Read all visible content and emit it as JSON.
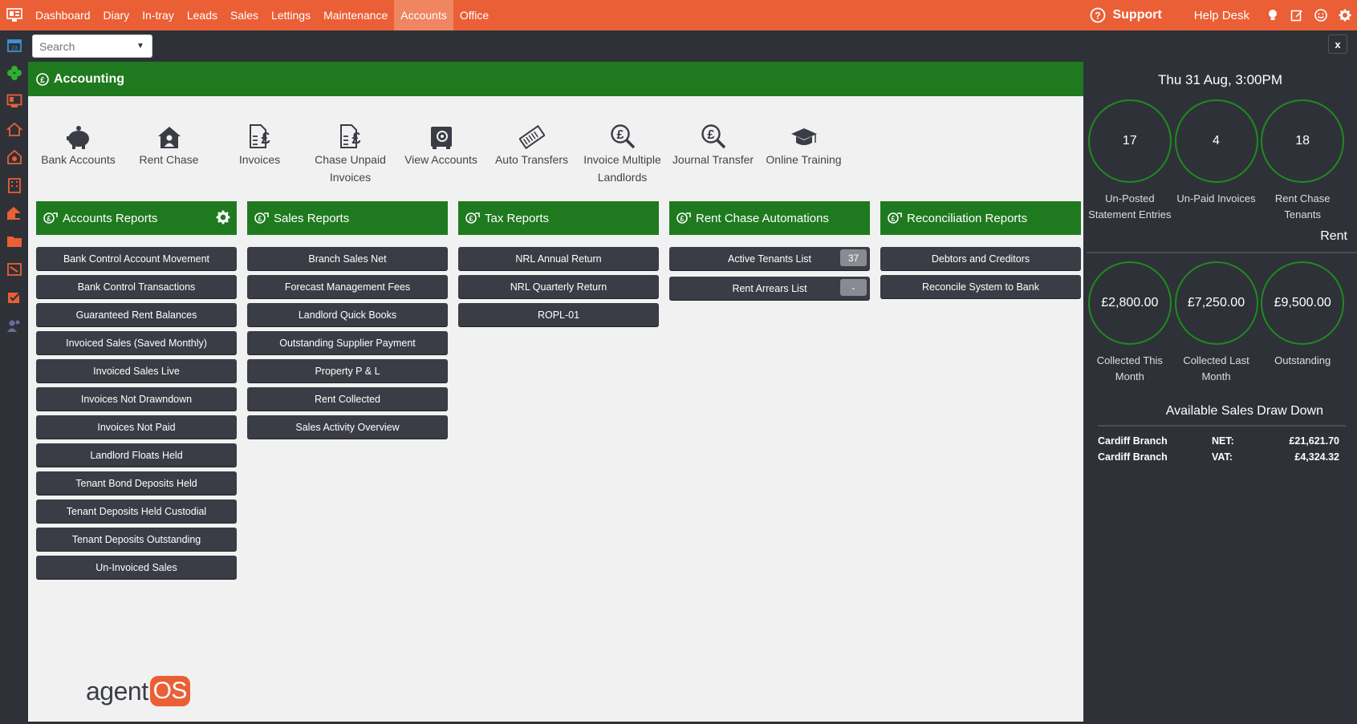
{
  "nav": {
    "items": [
      "Dashboard",
      "Diary",
      "In-tray",
      "Leads",
      "Sales",
      "Lettings",
      "Maintenance",
      "Accounts",
      "Office"
    ],
    "active": "Accounts",
    "support": "Support",
    "help_desk": "Help Desk"
  },
  "search": {
    "placeholder": "Search"
  },
  "close_label": "x",
  "page": {
    "title": "Accounting"
  },
  "tools": [
    {
      "label": "Bank Accounts",
      "icon": "piggy-bank-icon"
    },
    {
      "label": "Rent Chase",
      "icon": "house-user-icon"
    },
    {
      "label": "Invoices",
      "icon": "invoice-pound-icon"
    },
    {
      "label": "Chase Unpaid Invoices",
      "icon": "invoice-pound-icon"
    },
    {
      "label": "View Accounts",
      "icon": "safe-icon"
    },
    {
      "label": "Auto Transfers",
      "icon": "money-transfer-icon"
    },
    {
      "label": "Invoice Multiple Landlords",
      "icon": "search-pound-icon"
    },
    {
      "label": "Journal Transfer",
      "icon": "search-pound-icon"
    },
    {
      "label": "Online Training",
      "icon": "graduation-cap-icon"
    }
  ],
  "report_groups": [
    {
      "title": "Accounts Reports",
      "items": [
        "Bank Control Account Movement",
        "Bank Control Transactions",
        "Guaranteed Rent Balances",
        "Invoiced Sales (Saved Monthly)",
        "Invoiced Sales Live",
        "Invoices Not Drawndown",
        "Invoices Not Paid",
        "Landlord Floats Held",
        "Tenant Bond Deposits Held",
        "Tenant Deposits Held Custodial",
        "Tenant Deposits Outstanding",
        "Un-Invoiced Sales"
      ]
    },
    {
      "title": "Sales Reports",
      "items": [
        "Branch Sales Net",
        "Forecast Management Fees",
        "Landlord Quick Books",
        "Outstanding Supplier Payment",
        "Property P & L",
        "Rent Collected",
        "Sales Activity Overview"
      ]
    },
    {
      "title": "Tax Reports",
      "items": [
        "NRL Annual Return",
        "NRL Quarterly Return",
        "ROPL-01"
      ]
    },
    {
      "title": "Rent Chase Automations",
      "items": [
        "Active Tenants List",
        "Rent Arrears List"
      ],
      "badges": [
        "37",
        "-"
      ]
    },
    {
      "title": "Reconciliation Reports",
      "items": [
        "Debtors and Creditors",
        "Reconcile System to Bank"
      ]
    }
  ],
  "brand": {
    "left": "agent",
    "right": "OS"
  },
  "right_panel": {
    "datetime": "Thu 31 Aug, 3:00PM",
    "stats": [
      {
        "value": "17",
        "label": "Un-Posted Statement Entries"
      },
      {
        "value": "4",
        "label": "Un-Paid Invoices"
      },
      {
        "value": "18",
        "label": "Rent Chase Tenants"
      }
    ],
    "rent_title": "Rent",
    "rent": [
      {
        "value": "£2,800.00",
        "label": "Collected This Month"
      },
      {
        "value": "£7,250.00",
        "label": "Collected Last Month"
      },
      {
        "value": "£9,500.00",
        "label": "Outstanding"
      }
    ],
    "drawdown_title": "Available Sales Draw Down",
    "drawdown": [
      {
        "branch": "Cardiff Branch",
        "type": "NET:",
        "amount": "£21,621.70"
      },
      {
        "branch": "Cardiff Branch",
        "type": "VAT:",
        "amount": "£4,324.32"
      }
    ]
  },
  "colors": {
    "accent": "#ea5f36",
    "green": "#1f7a1f",
    "dark": "#2e3238",
    "button": "#3a3d46"
  }
}
